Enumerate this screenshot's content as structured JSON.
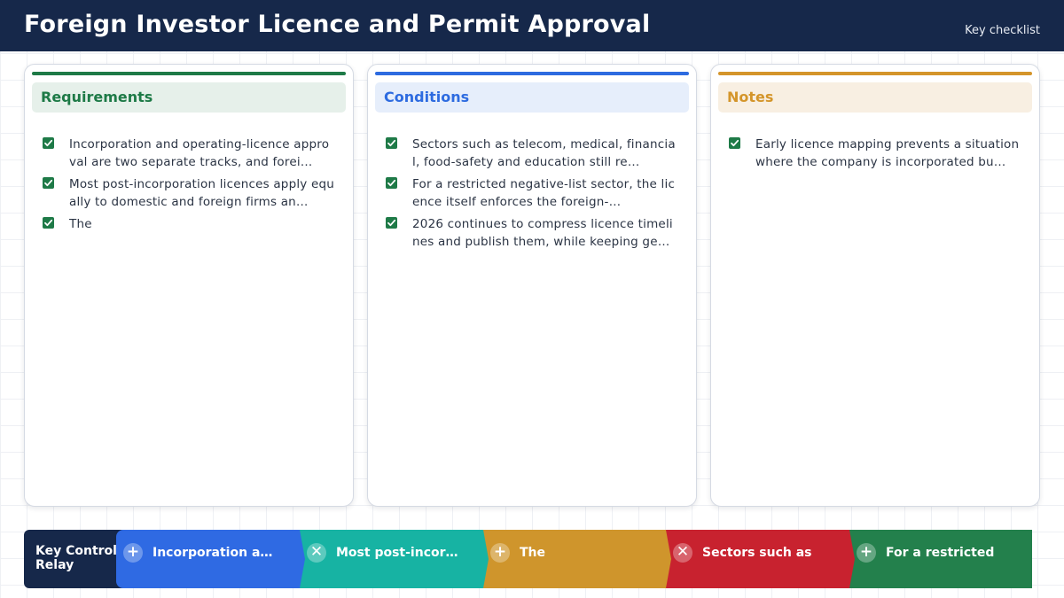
{
  "header": {
    "title": "Foreign Investor Licence and Permit Approval",
    "tag": "Key checklist"
  },
  "columns": [
    {
      "title": "Requirements",
      "accent": "#1e7a47",
      "tint": "#e6f0ea",
      "title_color": "#1e7a47",
      "items": [
        "Incorporation and operating-licence approval are two separate tracks, and forei…",
        "Most post-incorporation licences apply equally to domestic and foreign firms an…",
        "The"
      ]
    },
    {
      "title": "Conditions",
      "accent": "#2d6be0",
      "tint": "#e6eefb",
      "title_color": "#2d6be0",
      "items": [
        "Sectors such as telecom, medical, financial, food-safety and education still re…",
        "For a restricted negative-list sector, the licence itself enforces the foreign-…",
        "2026 continues to compress licence timelines and publish them, while keeping ge…"
      ]
    },
    {
      "title": "Notes",
      "accent": "#d4952a",
      "tint": "#f8efe2",
      "title_color": "#d4952a",
      "items": [
        "Early licence mapping prevents a situation where the company is incorporated bu…"
      ]
    }
  ],
  "relay": {
    "lead": "Key Control Relay",
    "segments": [
      {
        "icon": "plus-icon",
        "glyph": "+",
        "label": "Incorporation a…",
        "color": "#2f6ae3"
      },
      {
        "icon": "close-icon",
        "glyph": "✕",
        "label": "Most post-incor…",
        "color": "#17b3a3"
      },
      {
        "icon": "plus-icon",
        "glyph": "+",
        "label": "The",
        "color": "#cf952c"
      },
      {
        "icon": "close-icon",
        "glyph": "✕",
        "label": "Sectors such as",
        "color": "#c8222f"
      },
      {
        "icon": "plus-icon",
        "glyph": "+",
        "label": "For a restricted",
        "color": "#23804c"
      }
    ]
  }
}
